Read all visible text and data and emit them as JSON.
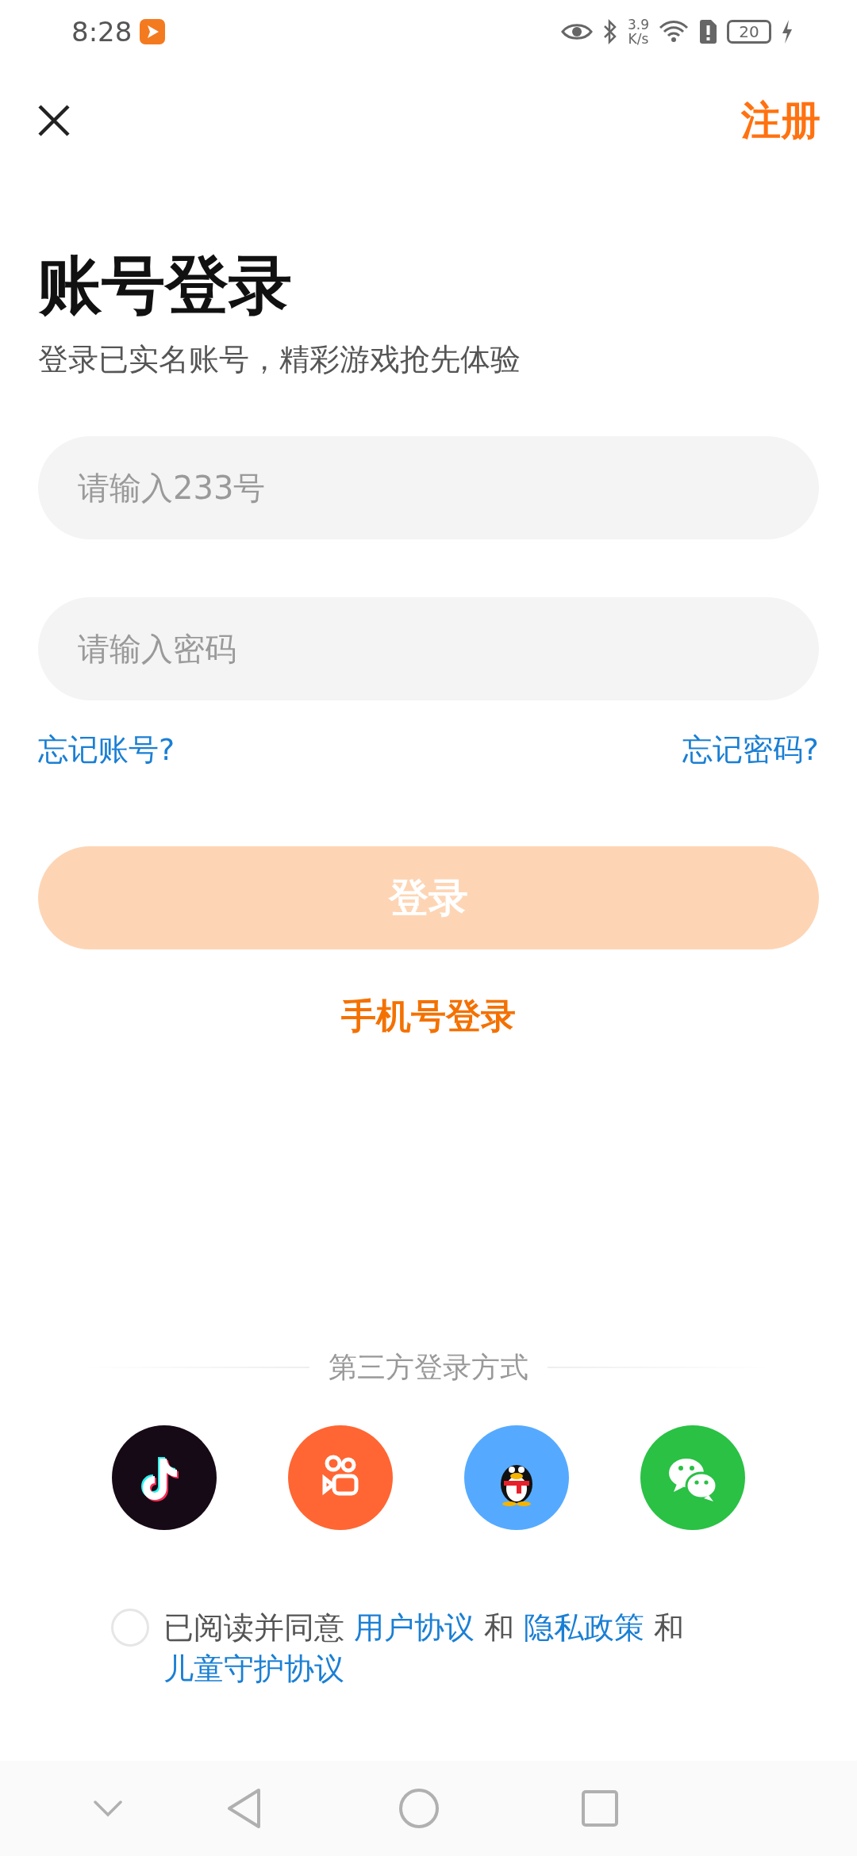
{
  "status_bar": {
    "time": "8:28",
    "speed_value": "3.9",
    "speed_unit": "K/s",
    "battery": "20"
  },
  "header": {
    "register": "注册"
  },
  "title": "账号登录",
  "subtitle": "登录已实名账号，精彩游戏抢先体验",
  "fields": [
    {
      "placeholder": "请输入233号"
    },
    {
      "placeholder": "请输入密码"
    }
  ],
  "forgot_account": "忘记账号?",
  "forgot_password": "忘记密码?",
  "login_button": {
    "label": "登录",
    "disabled": true
  },
  "phone_login": "手机号登录",
  "third_party": {
    "label": "第三方登录方式",
    "options": [
      {
        "kind": "note",
        "color": "#160a16"
      },
      {
        "kind": "camera",
        "color": "#ff6633"
      },
      {
        "kind": "penguin",
        "color": "#55aaff"
      },
      {
        "kind": "chat",
        "color": "#2ac145"
      }
    ]
  },
  "agreement": {
    "checked": false,
    "parts": [
      {
        "kind": "text",
        "text": "已阅读并同意 "
      },
      {
        "kind": "link",
        "text": "用户协议"
      },
      {
        "kind": "text",
        "text": " 和 "
      },
      {
        "kind": "link",
        "text": "隐私政策"
      },
      {
        "kind": "text",
        "text": " 和 "
      },
      {
        "kind": "link",
        "text": "儿童守护协议"
      }
    ]
  }
}
